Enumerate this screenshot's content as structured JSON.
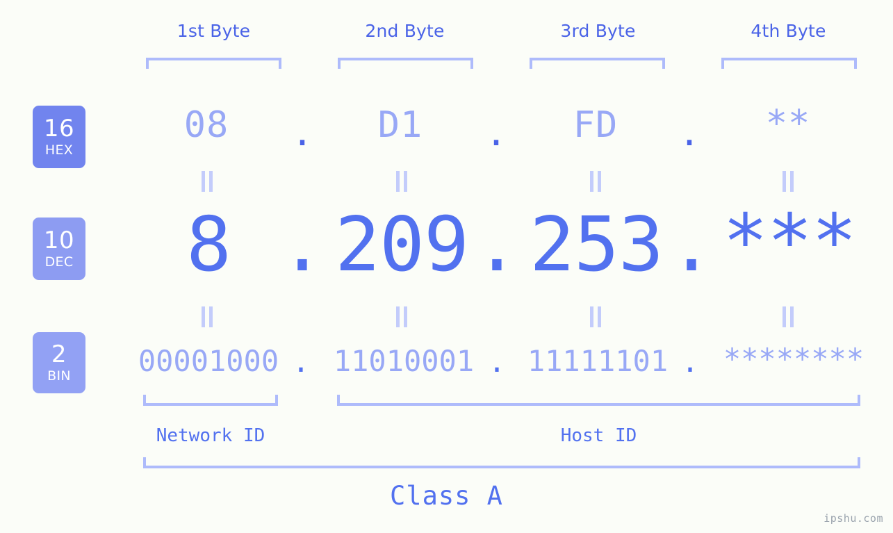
{
  "meta": {
    "watermark": "ipshu.com"
  },
  "headers": [
    {
      "label": "1st Byte"
    },
    {
      "label": "2nd Byte"
    },
    {
      "label": "3rd Byte"
    },
    {
      "label": "4th Byte"
    }
  ],
  "bases": [
    {
      "number": "16",
      "name": "HEX",
      "color": "#7184ee"
    },
    {
      "number": "10",
      "name": "DEC",
      "color": "#8d9cf2"
    },
    {
      "number": "2",
      "name": "BIN",
      "color": "#92a1f4"
    }
  ],
  "rows": {
    "hex": {
      "values": [
        "08",
        "D1",
        "FD",
        "**"
      ],
      "separator": "."
    },
    "dec": {
      "values": [
        "8",
        "209",
        "253",
        "***"
      ],
      "separator": "."
    },
    "bin": {
      "values": [
        "00001000",
        "11010001",
        "11111101",
        "********"
      ],
      "separator": "."
    }
  },
  "connector": "=",
  "sections": [
    {
      "label": "Network ID"
    },
    {
      "label": "Host ID"
    }
  ],
  "class": {
    "label": "Class A"
  },
  "colors": {
    "background": "#fbfdf8",
    "header_text": "#4a63e7",
    "bracket": "#aebbfb",
    "light_value": "#98a8f6",
    "strong_value": "#5271ef",
    "connector": "#c3ccfb"
  }
}
